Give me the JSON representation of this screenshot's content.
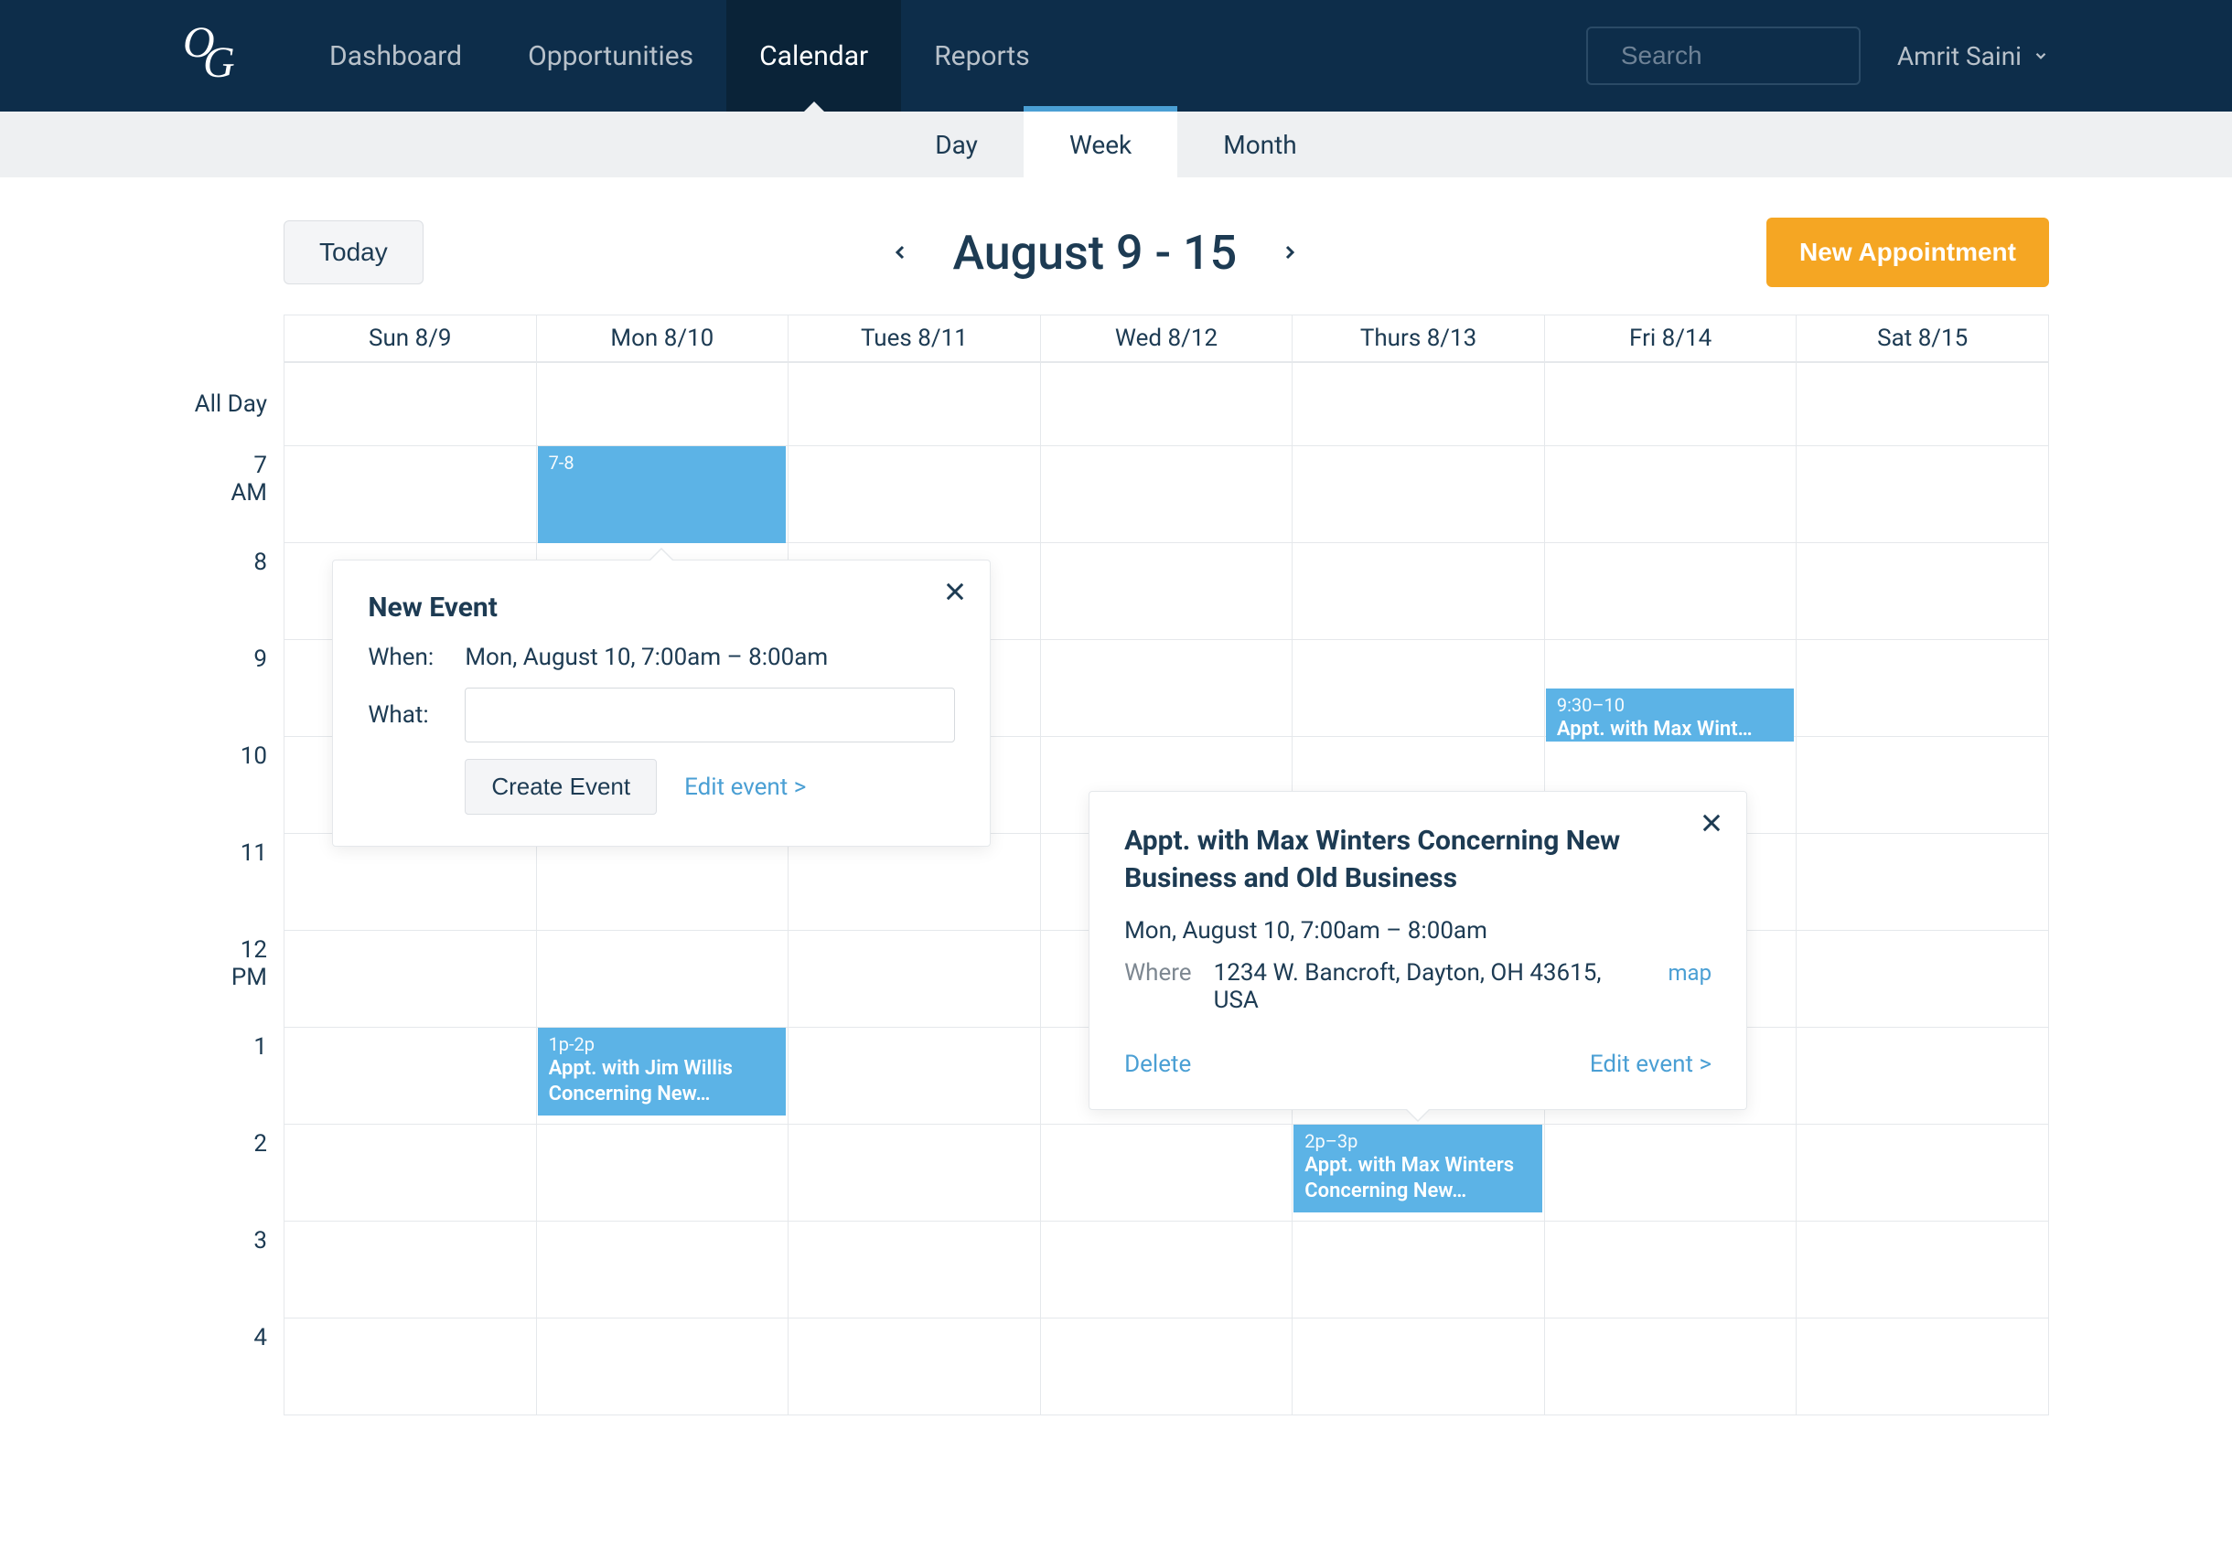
{
  "nav": {
    "items": [
      "Dashboard",
      "Opportunities",
      "Calendar",
      "Reports"
    ],
    "active_index": 2,
    "search_placeholder": "Search",
    "user_name": "Amrit Saini"
  },
  "subtabs": {
    "items": [
      "Day",
      "Week",
      "Month"
    ],
    "active_index": 1
  },
  "toolbar": {
    "today_label": "Today",
    "range_title": "August 9 - 15",
    "new_appt_label": "New Appointment"
  },
  "calendar": {
    "all_day_label": "All Day",
    "am_label": "AM",
    "pm_label": "PM",
    "days": [
      "Sun 8/9",
      "Mon 8/10",
      "Tues 8/11",
      "Wed 8/12",
      "Thurs 8/13",
      "Fri 8/14",
      "Sat 8/15"
    ],
    "hours": [
      "7",
      "8",
      "9",
      "10",
      "11",
      "12",
      "1",
      "2",
      "3",
      "4"
    ]
  },
  "events": {
    "ev1": {
      "time": "7-8",
      "title": ""
    },
    "ev2": {
      "time": "1p-2p",
      "title": "Appt. with Jim Willis Concerning New…"
    },
    "ev3": {
      "time": "2p–3p",
      "title": "Appt. with Max Winters Concerning New…"
    },
    "ev4": {
      "time": "9:30–10",
      "title": "Appt. with Max Wint…"
    }
  },
  "new_event_popover": {
    "title": "New Event",
    "when_label": "When:",
    "when_value": "Mon, August 10, 7:00am – 8:00am",
    "what_label": "What:",
    "what_value": "",
    "create_label": "Create Event",
    "edit_label": "Edit event >"
  },
  "detail_popover": {
    "title": "Appt. with Max Winters Concerning New Business and Old Business",
    "when_value": "Mon, August 10, 7:00am – 8:00am",
    "where_label": "Where",
    "address": "1234 W. Bancroft, Dayton, OH 43615, USA",
    "map_label": "map",
    "delete_label": "Delete",
    "edit_label": "Edit event >"
  }
}
